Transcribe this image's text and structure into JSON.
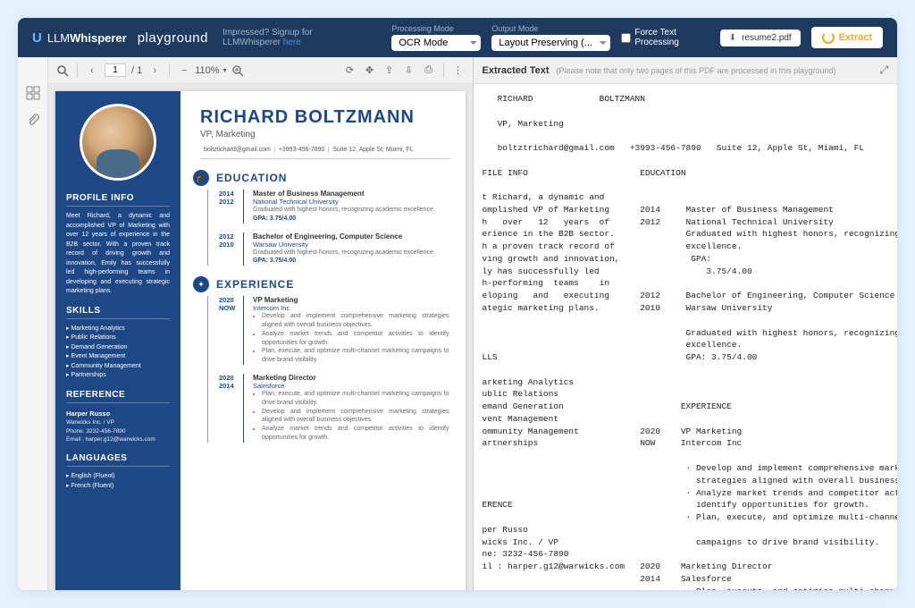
{
  "header": {
    "brand_mark": "U",
    "brand_prefix": "LLM",
    "brand_suffix": "Whisperer",
    "playground": "playground",
    "tagline": "Impressed? Signup for LLMWhisperer",
    "tagline_link": "here",
    "proc_label": "Processing Mode",
    "proc_value": "OCR Mode",
    "out_label": "Output Mode",
    "out_value": "Layout Preserving (...",
    "force": "Force Text Processing",
    "file": "resume2.pdf",
    "extract": "Extract"
  },
  "toolbar": {
    "page": "1",
    "pages": "/ 1",
    "zoom": "110%"
  },
  "ext": {
    "title": "Extracted Text",
    "note": "(Please note that only two pages of this PDF are processed in this playground)"
  },
  "doc": {
    "name": "RICHARD BOLTZMANN",
    "role": "VP, Marketing",
    "contact": {
      "email": "boltztichard@gmail.com",
      "phone": "+3993-456-7890",
      "addr": "Suite 12, Apple St, Miami, FL"
    },
    "profile_h": "PROFILE INFO",
    "profile": "Meet Richard, a dynamic and accomplished VP of Marketing with over 12 years of experience in the B2B sector. With a proven track record of driving growth and innovation, Emily has successfully led high-performing teams in developing and executing strategic marketing plans.",
    "skills_h": "SKILLS",
    "skills": [
      "Marketing Analytics",
      "Public Relations",
      "Demand Generation",
      "Event Management",
      "Community Management",
      "Partnerships"
    ],
    "ref_h": "REFERENCE",
    "ref": {
      "name": "Harper Russo",
      "co": "Warwicks Inc. / VP",
      "phone": "Phone:  3232-456-7890",
      "email": "Email :  harper.g12@warwicks.com"
    },
    "lang_h": "LANGUAGES",
    "langs": [
      "English (Fluent)",
      "French (Fluent)"
    ],
    "edu_h": "EDUCATION",
    "edu": [
      {
        "y1": "2014",
        "y2": "2012",
        "t": "Master of Business Management",
        "s": "National Technical University",
        "d": "Graduated with highest honors, recognizing academic excellence.",
        "g": "GPA: 3.75/4.00"
      },
      {
        "y1": "2012",
        "y2": "2010",
        "t": "Bachelor of Engineering, Computer Science",
        "s": "Warsaw University",
        "d": "Graduated with highest honors, recognizing academic excellence.",
        "g": "GPA: 3.75/4.00"
      }
    ],
    "exp_h": "EXPERIENCE",
    "exp": [
      {
        "y1": "2020",
        "y2": "NOW",
        "t": "VP Marketing",
        "s": "Intercom Inc",
        "b": [
          "Develop and implement comprehensive marketing strategies aligned with overall business objectives.",
          "Analyze market trends and competitor activities to identify opportunities for growth.",
          "Plan, execute, and optimize multi-channel marketing campaigns to drive brand visibility."
        ]
      },
      {
        "y1": "2020",
        "y2": "2014",
        "t": "Marketing Director",
        "s": "Salesforce",
        "b": [
          "Plan, execute, and optimize multi-channel marketing campaigns to drive brand visibility.",
          "Develop and implement comprehensive marketing strategies aligned with overall business objectives.",
          "Analyze market trends and competitor activities to identify opportunities for growth."
        ]
      }
    ]
  },
  "extracted": "   RICHARD             BOLTZMANN\n\n   VP, Marketing\n\n   boltztrichard@gmail.com   +3993-456-7890   Suite 12, Apple St, Miami, FL\n\nFILE INFO                      EDUCATION\n\nt Richard, a dynamic and\nomplished VP of Marketing      2014     Master of Business Management\nh   over   12   years  of      2012     National Technical University\nerience in the B2B sector.              Graduated with highest honors, recognizing academic\nh a proven track record of              excellence.\nving growth and innovation,              GPA:\nly has successfully led                     3.75/4.00\nh-performing  teams    in\neloping   and   executing      2012     Bachelor of Engineering, Computer Science\nategic marketing plans.        2010     Warsaw University\n\n                                        Graduated with highest honors, recognizing academic\n                                        excellence.\nLLS                                     GPA: 3.75/4.00\n\narketing Analytics\nublic Relations\nemand Generation                       EXPERIENCE\nvent Management\nommunity Management            2020    VP Marketing\nartnerships                    NOW     Intercom Inc\n\n                                        · Develop and implement comprehensive marketing\n                                          strategies aligned with overall business objectives.\n                                        · Analyze market trends and competitor activities to\nERENCE                                    identify opportunities for growth.\n                                        · Plan, execute, and optimize multi-channel marketing\nper Russo\nwicks Inc. / VP                           campaigns to drive brand visibility.\nne: 3232-456-7890\nil : harper.g12@warwicks.com   2020    Marketing Director\n                               2014    Salesforce\n                                        · Plan, execute, and optimize multi-channel marketing\nGUAGES                                    campaigns to drive brand visibility.\n                                        · Develop and implement comprehensive marketing\nnglish (Fluent)                           strategies aligned with overall business objectives.\nrench (Fluent)\nerman (Basics)                          · Analyze market trends and competitor activities to\n                                          identify opportunities for growth."
}
